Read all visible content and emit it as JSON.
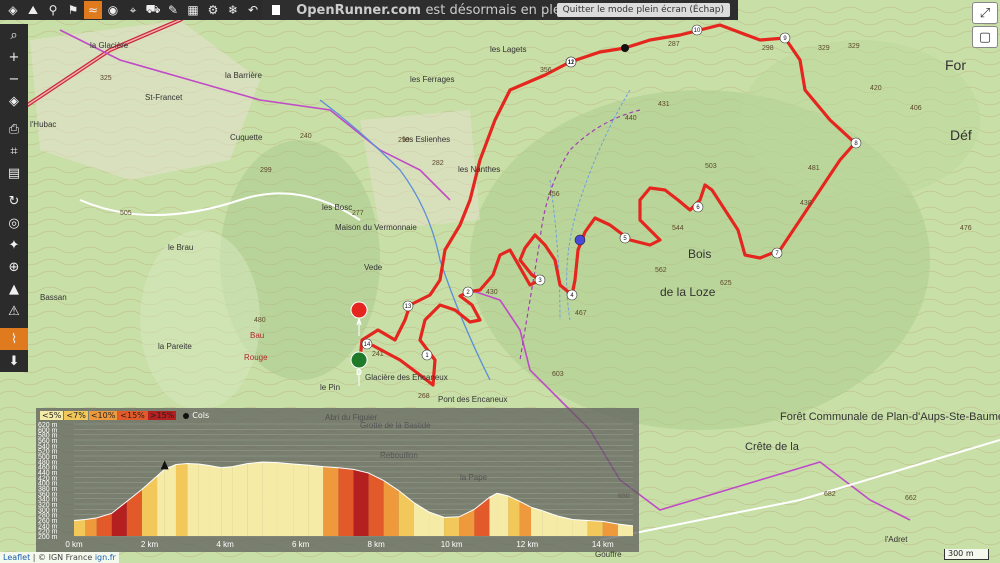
{
  "top_toolbar": {
    "icons": [
      "layers-icon",
      "hiking-icon",
      "bicycle-icon",
      "walker-icon",
      "wave-icon",
      "eye-icon",
      "pin-icon",
      "car-icon",
      "edit-icon",
      "grid-icon",
      "bike-icon",
      "ski-icon",
      "back-icon"
    ]
  },
  "left_toolbar": {
    "icons": [
      "search-icon",
      "plus-icon",
      "minus-icon",
      "layers-icon",
      "print-icon",
      "crop-icon",
      "chart-icon",
      "refresh-icon",
      "locate-icon",
      "compass-icon",
      "globe-icon",
      "terrain-icon",
      "warning-icon",
      "profile-icon",
      "download-icon"
    ]
  },
  "banner": {
    "title": "OpenRunner.com",
    "text": "est désormais en plein écran",
    "button": "Quitter le mode plein écran (Échap)"
  },
  "right_controls": {
    "fullscreen": "⤢",
    "view": "▢"
  },
  "map_labels": [
    "la Glacière",
    "la Barrière",
    "St-Francet",
    "l'Hubac",
    "Cuquette",
    "les Ferrages",
    "les Lagets",
    "les Eslienhes",
    "les Bosc",
    "Maison du Vermonnaie",
    "les Nanthes",
    "Vede",
    "le Brau",
    "Bassan",
    "la Pareite",
    "Bau",
    "Rouge",
    "le Pin",
    "Bois",
    "de la Loze",
    "Pont des Encaneux",
    "Glacière des Encaneux",
    "Forêt Communale de Plan-d'Aups-Ste-Baume",
    "Crête de la",
    "l'Adret",
    "Déf",
    "For",
    "Gouffre",
    "Abri du Figuier",
    "Grotte de la Bastide",
    "Rebouillon",
    "la Pape"
  ],
  "elevations": [
    "287",
    "298",
    "329",
    "329",
    "503",
    "544",
    "481",
    "438",
    "625",
    "562",
    "467",
    "430",
    "603",
    "456",
    "440",
    "431",
    "505",
    "480",
    "345",
    "259",
    "356",
    "241",
    "268",
    "277",
    "282",
    "650",
    "682",
    "662",
    "476",
    "406",
    "420",
    "240",
    "325",
    "299"
  ],
  "route_markers": [
    "1",
    "2",
    "3",
    "4",
    "5",
    "6",
    "7",
    "8",
    "9",
    "10",
    "11",
    "12",
    "13",
    "14"
  ],
  "start_marker": "A",
  "end_marker": "D",
  "profile": {
    "legend": [
      {
        "label": "<5%",
        "color": "#f6eba6"
      },
      {
        "label": "<7%",
        "color": "#f2c85a"
      },
      {
        "label": "<10%",
        "color": "#ee9a3c"
      },
      {
        "label": "<15%",
        "color": "#e25a2a"
      },
      {
        "label": ">15%",
        "color": "#b42020"
      }
    ],
    "cols_label": "Cols"
  },
  "chart_data": {
    "type": "area",
    "title": "",
    "xlabel": "",
    "ylabel": "",
    "xlim": [
      0,
      14.8
    ],
    "ylim": [
      200,
      620
    ],
    "y_ticks": [
      "620 m",
      "600 m",
      "580 m",
      "560 m",
      "540 m",
      "520 m",
      "500 m",
      "480 m",
      "460 m",
      "440 m",
      "420 m",
      "400 m",
      "380 m",
      "360 m",
      "340 m",
      "320 m",
      "300 m",
      "280 m",
      "260 m",
      "240 m",
      "220 m",
      "200 m"
    ],
    "x_ticks": [
      "0 km",
      "2 km",
      "4 km",
      "6 km",
      "8 km",
      "10 km",
      "12 km",
      "14 km"
    ],
    "series": [
      {
        "x": [
          0,
          0.3,
          0.6,
          1,
          1.4,
          1.8,
          2.2,
          2.4,
          2.7,
          3.0,
          3.3,
          3.6,
          3.9,
          4.2,
          4.6,
          5,
          5.4,
          5.8,
          6.2,
          6.6,
          7,
          7.4,
          7.8,
          8.2,
          8.6,
          9,
          9.4,
          9.8,
          10.2,
          10.6,
          11,
          11.2,
          11.5,
          11.8,
          12.1,
          12.4,
          12.8,
          13.2,
          13.6,
          14,
          14.4,
          14.8
        ],
        "y": [
          258,
          262,
          268,
          285,
          330,
          375,
          425,
          450,
          468,
          472,
          470,
          464,
          456,
          460,
          472,
          477,
          475,
          470,
          466,
          460,
          456,
          450,
          436,
          408,
          370,
          325,
          290,
          270,
          272,
          300,
          345,
          360,
          350,
          330,
          308,
          295,
          275,
          262,
          258,
          255,
          245,
          238
        ]
      }
    ],
    "colors": [
      "#f2c85a",
      "#ee9a3c",
      "#e25a2a",
      "#b42020",
      "#e25a2a",
      "#f2c85a",
      "#f6eba6",
      "#f6eba6",
      "#f2c85a",
      "#f6eba6",
      "#f6eba6",
      "#f6eba6",
      "#f6eba6",
      "#f6eba6",
      "#f6eba6",
      "#f6eba6",
      "#f6eba6",
      "#f6eba6",
      "#f6eba6",
      "#ee9a3c",
      "#e25a2a",
      "#b42020",
      "#e25a2a",
      "#ee9a3c",
      "#f2c85a",
      "#f6eba6",
      "#f6eba6",
      "#f2c85a",
      "#ee9a3c",
      "#e25a2a",
      "#f6eba6",
      "#f6eba6",
      "#f2c85a",
      "#ee9a3c",
      "#f6eba6",
      "#f6eba6",
      "#f6eba6",
      "#f6eba6",
      "#f2c85a",
      "#ee9a3c",
      "#f6eba6"
    ],
    "col_x": 2.4,
    "grid": true
  },
  "scale_bar": "300 m",
  "attribution": {
    "leaflet": "Leaflet",
    "source": "| © IGN France",
    "link": "ign.fr"
  }
}
